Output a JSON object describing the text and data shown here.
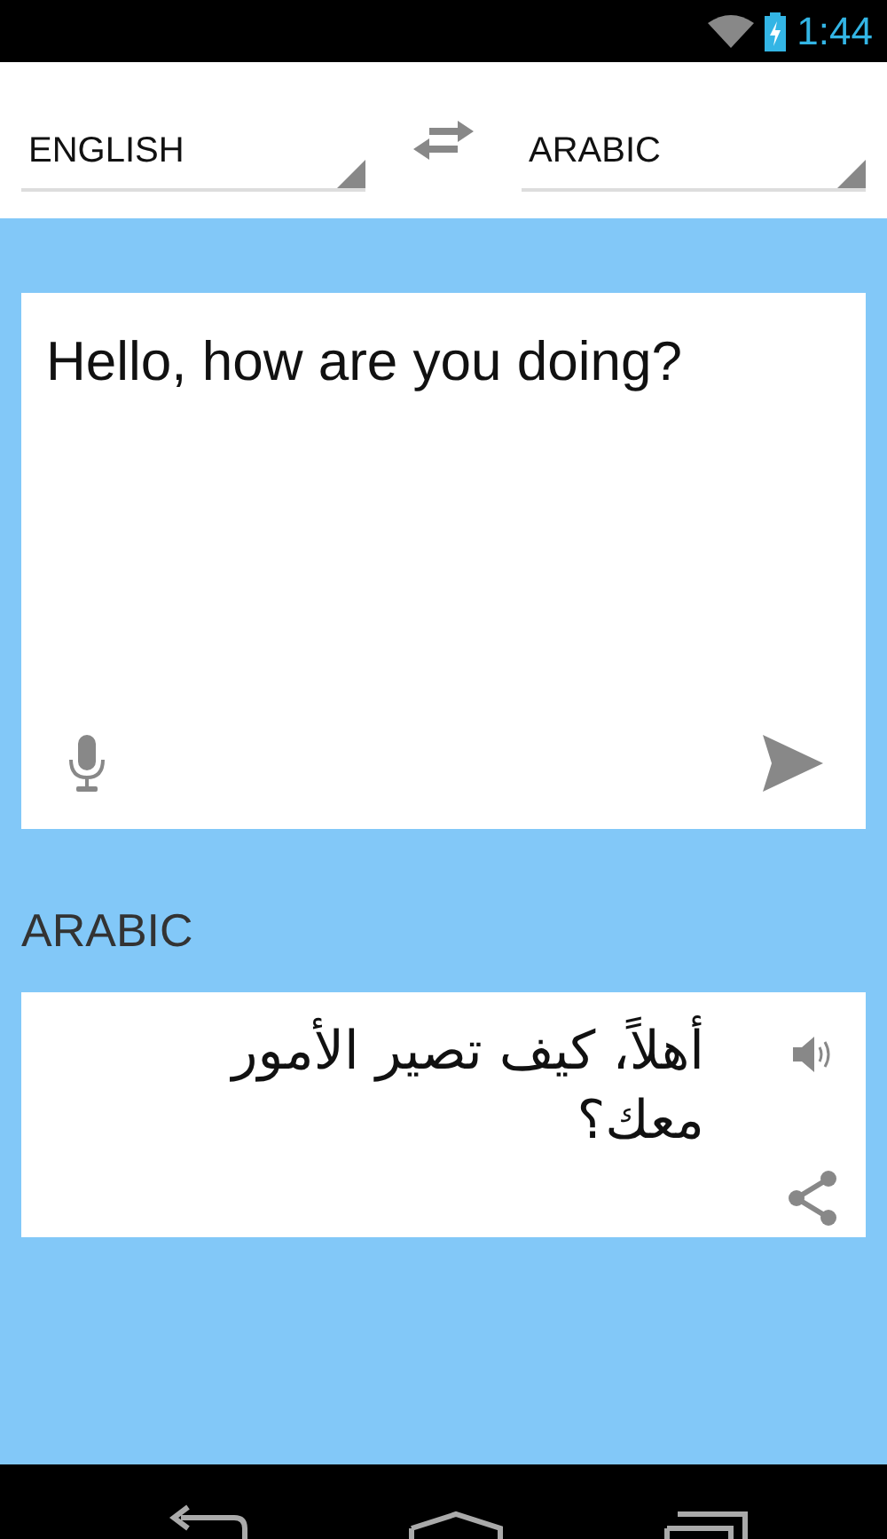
{
  "status_bar": {
    "time": "1:44"
  },
  "languages": {
    "source": "ENGLISH",
    "target": "ARABIC"
  },
  "input": {
    "value": "Hello, how are you doing?"
  },
  "output": {
    "label": "ARABIC",
    "text": "أهلاً، كيف تصير الأمور معك؟"
  }
}
